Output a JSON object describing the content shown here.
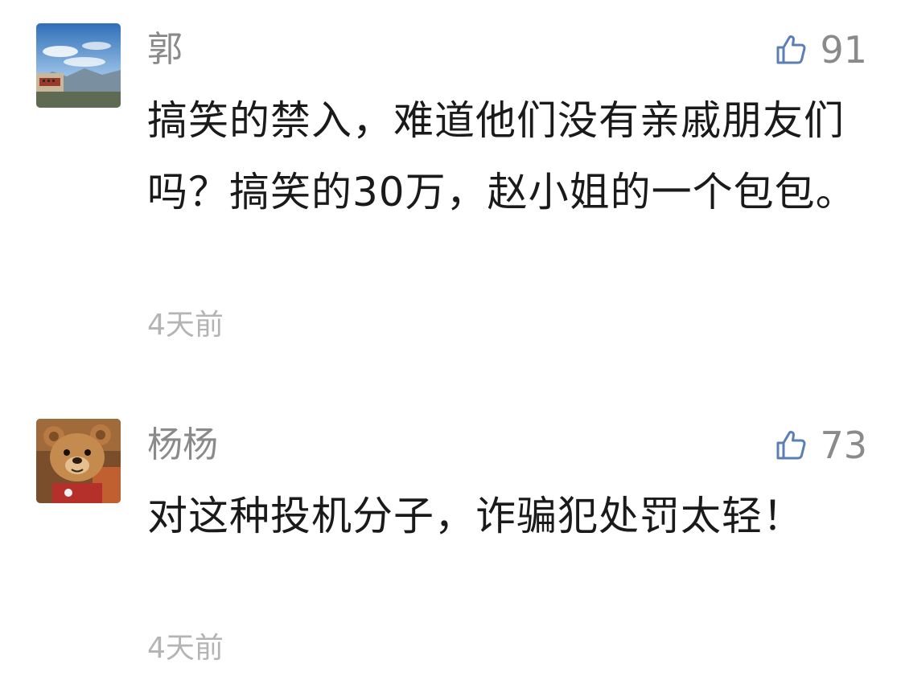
{
  "comments": [
    {
      "author": "郭",
      "likes": "91",
      "text": "搞笑的禁入，难道他们没有亲戚朋友们吗？搞笑的30万，赵小姐的一个包包。",
      "time": "4天前",
      "avatar_icon": "landscape-palace-avatar",
      "like_icon": "thumbs-up-icon"
    },
    {
      "author": "杨杨",
      "likes": "73",
      "text": "对这种投机分子，诈骗犯处罚太轻！",
      "time": "4天前",
      "avatar_icon": "teddy-bear-avatar",
      "like_icon": "thumbs-up-icon"
    }
  ],
  "colors": {
    "name": "#8a8a8a",
    "text": "#1a1a1a",
    "time": "#b4b4b4",
    "like_icon": "#5b7fb5"
  }
}
